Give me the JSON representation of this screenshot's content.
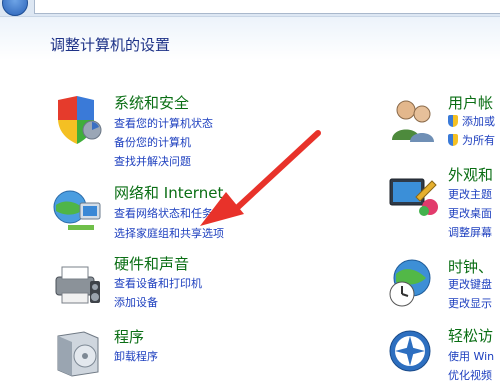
{
  "page": {
    "title": "调整计算机的设置"
  },
  "categories_left": [
    {
      "name": "security",
      "title": "系统和安全",
      "links": [
        "查看您的计算机状态",
        "备份您的计算机",
        "查找并解决问题"
      ]
    },
    {
      "name": "network",
      "title": "网络和 Internet",
      "links": [
        "查看网络状态和任务",
        "选择家庭组和共享选项"
      ]
    },
    {
      "name": "hardware",
      "title": "硬件和声音",
      "links": [
        "查看设备和打印机",
        "添加设备"
      ]
    },
    {
      "name": "programs",
      "title": "程序",
      "links": [
        "卸载程序"
      ]
    }
  ],
  "categories_right": [
    {
      "name": "user-accounts",
      "title": "用户帐",
      "links": [
        "添加或",
        "为所有"
      ]
    },
    {
      "name": "appearance",
      "title": "外观和",
      "links": [
        "更改主题",
        "更改桌面",
        "调整屏幕"
      ]
    },
    {
      "name": "clock",
      "title": "时钟、",
      "links": [
        "更改键盘",
        "更改显示"
      ]
    },
    {
      "name": "ease-of-access",
      "title": "轻松访",
      "links": [
        "使用 Win",
        "优化视频"
      ]
    }
  ],
  "colors": {
    "heading": "#1e3287",
    "category": "#0a6e14",
    "link": "#1d3fbf",
    "arrow": "#e8322a"
  }
}
